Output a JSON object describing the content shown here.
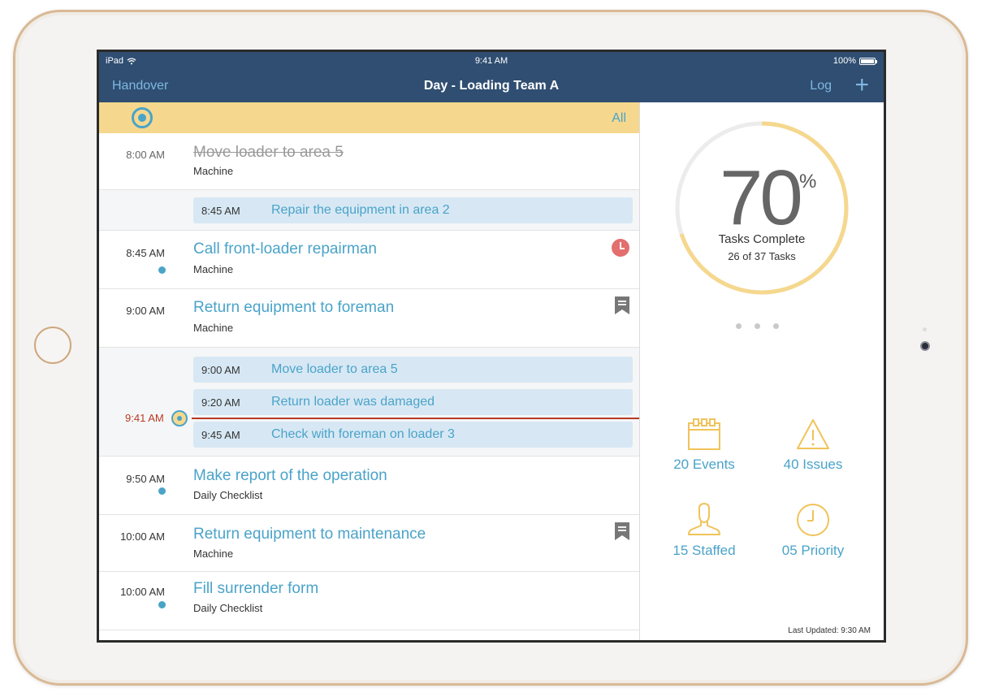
{
  "status_bar": {
    "device": "iPad",
    "time": "9:41 AM",
    "battery": "100%"
  },
  "nav": {
    "left": "Handover",
    "title": "Day - Loading Team A",
    "log": "Log",
    "add": "+"
  },
  "filter": {
    "label": "All"
  },
  "rows": [
    {
      "time": "8:00 AM",
      "title": "Move loader to area 5",
      "subtitle": "Machine",
      "done": true
    },
    {
      "time": "8:45 AM",
      "title": "Repair the equipment in area 2"
    },
    {
      "time": "8:45 AM",
      "title": "Call front-loader repairman",
      "subtitle": "Machine",
      "flag": "alarm-icon"
    },
    {
      "time": "9:00 AM",
      "title": "Return equipment to foreman",
      "subtitle": "Machine",
      "flag": "bookmark-icon"
    },
    {
      "time": "9:00 AM",
      "title": "Move loader to area 5"
    },
    {
      "time": "9:20 AM",
      "title": "Return loader was damaged"
    },
    {
      "time": "9:45 AM",
      "title": "Check with foreman on loader 3"
    },
    {
      "time": "9:50 AM",
      "title": "Make report of the operation",
      "subtitle": "Daily Checklist"
    },
    {
      "time": "10:00 AM",
      "title": "Return equipment to maintenance",
      "subtitle": "Machine",
      "flag": "bookmark-icon"
    },
    {
      "time": "10:00 AM",
      "title": "Fill surrender form",
      "subtitle": "Daily Checklist"
    }
  ],
  "now": {
    "time": "9:41 AM"
  },
  "stats": {
    "percent": "70",
    "percent_sign": "%",
    "percent_fraction": 0.7,
    "label": "Tasks Complete",
    "sub": "26 of 37 Tasks",
    "events": "20 Events",
    "issues": "40 Issues",
    "staffed": "15 Staffed",
    "priority": "05 Priority",
    "last_updated": "Last Updated: 9:30 AM"
  },
  "colors": {
    "nav_bg": "#2f4e72",
    "accent": "#4aa3c9",
    "filter_bg": "#f5d88e",
    "ring": "#f5d88e",
    "now_line": "#b83a24",
    "icon_gold": "#f0c35a"
  }
}
